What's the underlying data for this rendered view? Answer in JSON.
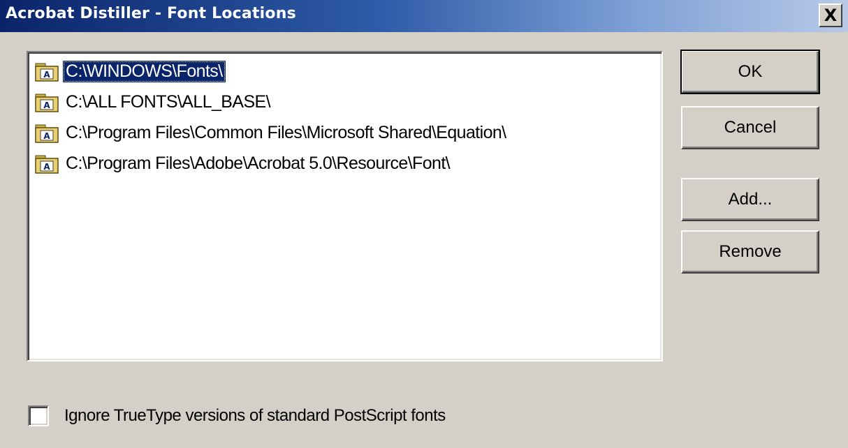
{
  "window": {
    "title": "Acrobat Distiller - Font Locations",
    "close_label": "X"
  },
  "font_list": {
    "items": [
      {
        "label": "C:\\WINDOWS\\Fonts\\",
        "selected": true
      },
      {
        "label": "C:\\ALL FONTS\\ALL_BASE\\",
        "selected": false
      },
      {
        "label": "C:\\Program Files\\Common Files\\Microsoft Shared\\Equation\\",
        "selected": false
      },
      {
        "label": "C:\\Program Files\\Adobe\\Acrobat 5.0\\Resource\\Font\\",
        "selected": false
      }
    ]
  },
  "buttons": {
    "ok_label": "OK",
    "cancel_label": "Cancel",
    "add_label": "Add...",
    "remove_label": "Remove"
  },
  "options": {
    "ignore_truetype_label": "Ignore TrueType versions of standard PostScript fonts",
    "ignore_truetype_checked": false
  },
  "colors": {
    "selection_bg": "#0a246a",
    "titlebar_start": "#0a246a",
    "titlebar_end": "#b7c9e6",
    "face": "#d4d0c8"
  },
  "icons": {
    "list_item": "font-folder-icon",
    "close": "close-icon"
  }
}
